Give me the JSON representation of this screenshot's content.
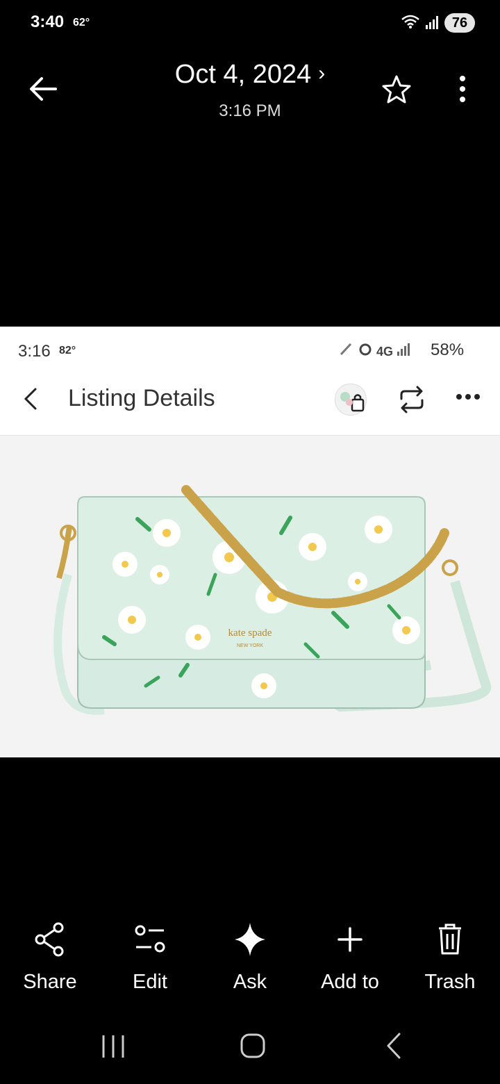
{
  "status_bar": {
    "time": "3:40",
    "temp": "62°",
    "battery": "76"
  },
  "header": {
    "date": "Oct 4, 2024",
    "time": "3:16 PM"
  },
  "screenshot": {
    "status_time": "3:16",
    "status_temp": "82°",
    "status_network": "4G",
    "status_battery": "58%",
    "title": "Listing Details",
    "brand_text": "kate spade",
    "brand_sub": "NEW YORK"
  },
  "actions": [
    {
      "label": "Share",
      "icon": "share-icon"
    },
    {
      "label": "Edit",
      "icon": "edit-icon"
    },
    {
      "label": "Ask",
      "icon": "sparkle-icon"
    },
    {
      "label": "Add to",
      "icon": "plus-icon"
    },
    {
      "label": "Trash",
      "icon": "trash-icon"
    }
  ],
  "colors": {
    "bag": "#d6ebe1",
    "chain": "#c9a24a",
    "leaf": "#3aa45a",
    "daisy_center": "#f2c94c"
  }
}
